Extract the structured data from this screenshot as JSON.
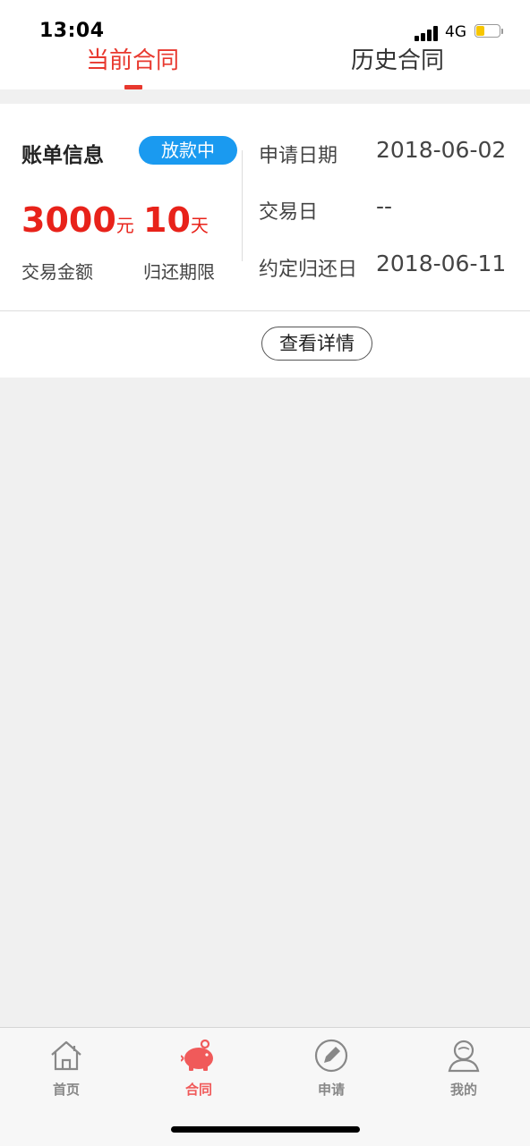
{
  "status_bar": {
    "time": "13:04",
    "network": "4G"
  },
  "tabs": [
    {
      "label": "当前合同",
      "active": true
    },
    {
      "label": "历史合同",
      "active": false
    }
  ],
  "bill": {
    "title": "账单信息",
    "badge": "放款中",
    "amount_value": "3000",
    "amount_unit": "元",
    "amount_label": "交易金额",
    "term_value": "10",
    "term_unit": "天",
    "term_label": "归还期限",
    "rows": [
      {
        "label": "申请日期",
        "value": "2018-06-02"
      },
      {
        "label": "交易日",
        "value": "--"
      },
      {
        "label": "约定归还日",
        "value": "2018-06-11"
      }
    ]
  },
  "detail_button": "查看详情",
  "tabbar": [
    {
      "label": "首页",
      "icon": "home-icon",
      "active": false
    },
    {
      "label": "合同",
      "icon": "piggy-bank-icon",
      "active": true
    },
    {
      "label": "申请",
      "icon": "pencil-icon",
      "active": false
    },
    {
      "label": "我的",
      "icon": "user-icon",
      "active": false
    }
  ],
  "colors": {
    "accent": "#e8382e",
    "badge": "#1a9af0",
    "tabbar_active": "#f05a5a"
  }
}
